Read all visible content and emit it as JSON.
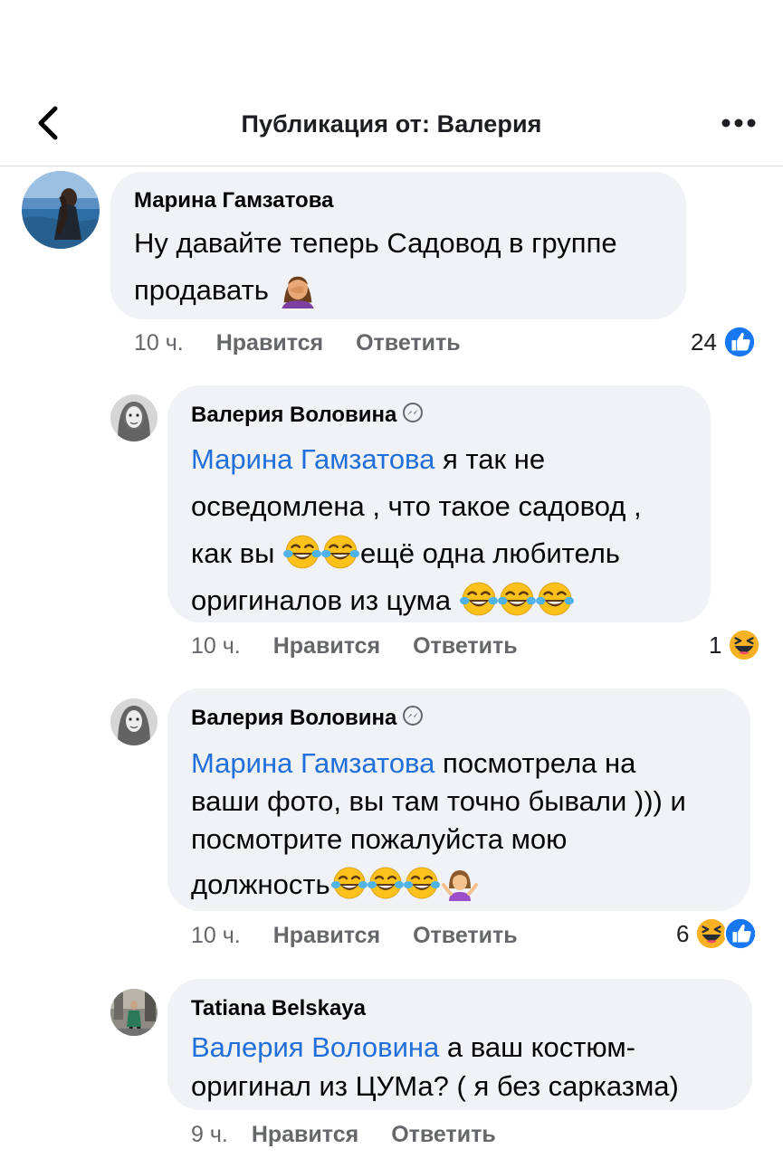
{
  "header": {
    "title": "Публикация от: Валерия"
  },
  "comments": [
    {
      "author": "Марина Гамзатова",
      "line1": "Ну давайте теперь Садовод в группе",
      "line2": "продавать",
      "time": "10 ч.",
      "like_label": "Нравится",
      "reply_label": "Ответить",
      "reaction_count": "24"
    },
    {
      "author": "Валерия Воловина",
      "mention": "Марина Гамзатова",
      "line1_rest": " я так не",
      "line2": "осведомлена , что такое садовод ,",
      "line3_a": "как вы ",
      "line3_b": "ещё одна любитель",
      "line4": "оригиналов из цума ",
      "time": "10 ч.",
      "like_label": "Нравится",
      "reply_label": "Ответить",
      "reaction_count": "1"
    },
    {
      "author": "Валерия Воловина",
      "mention": "Марина Гамзатова",
      "line1_rest": " посмотрела на",
      "line2": "ваши фото, вы там точно бывали ))) и",
      "line3": "посмотрите пожалуйста мою",
      "line4": "должность",
      "time": "10 ч.",
      "like_label": "Нравится",
      "reply_label": "Ответить",
      "reaction_count": "6"
    },
    {
      "author": "Tatiana Belskaya",
      "mention": "Валерия Воловина",
      "line1_rest": " а ваш костюм-",
      "line2": "оригинал из ЦУМа? ( я без сарказма)",
      "time": "9 ч.",
      "like_label": "Нравится",
      "reply_label": "Ответить"
    }
  ],
  "icons": {
    "back": "chevron-left-icon",
    "more": "more-dots-icon",
    "badge": "messenger-badge-icon",
    "like": "like-reaction-icon",
    "haha": "haha-reaction-icon",
    "tears_of_joy": "tears-of-joy-emoji",
    "facepalm": "facepalm-emoji",
    "shrug": "shrug-emoji"
  },
  "colors": {
    "mention": "#216fdb",
    "bubble": "#f0f2f5",
    "meta": "#65676b",
    "like_blue": "#1877f2",
    "haha_yellow": "#f7b125"
  }
}
